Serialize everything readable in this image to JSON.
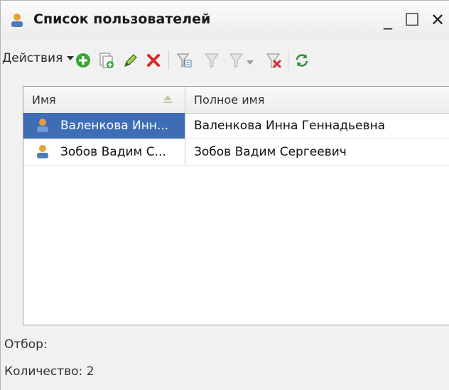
{
  "window": {
    "title": "Список пользователей",
    "minimize_glyph": "_",
    "maximize_glyph": "☐",
    "close_glyph": "✕"
  },
  "toolbar": {
    "actions_label": "Действия",
    "icons": [
      "add-icon",
      "copy-icon",
      "edit-icon",
      "delete-icon",
      "filter-icon",
      "filter-disabled-icon",
      "filter-history-icon",
      "clear-filter-icon",
      "refresh-icon"
    ]
  },
  "grid": {
    "columns": [
      "Имя",
      "Полное имя"
    ],
    "rows": [
      {
        "name": "Валенкова Инн...",
        "full_name": "Валенкова Инна Геннадьевна",
        "selected": true
      },
      {
        "name": "Зобов Вадим С...",
        "full_name": "Зобов Вадим Сергеевич",
        "selected": false
      }
    ]
  },
  "footer": {
    "filter_label": "Отбор:",
    "count_label": "Количество: 2"
  },
  "colors": {
    "selection": "#3e6db6",
    "add_green": "#3aa538",
    "delete_red": "#d9272b",
    "refresh_green": "#2f8f2f"
  }
}
